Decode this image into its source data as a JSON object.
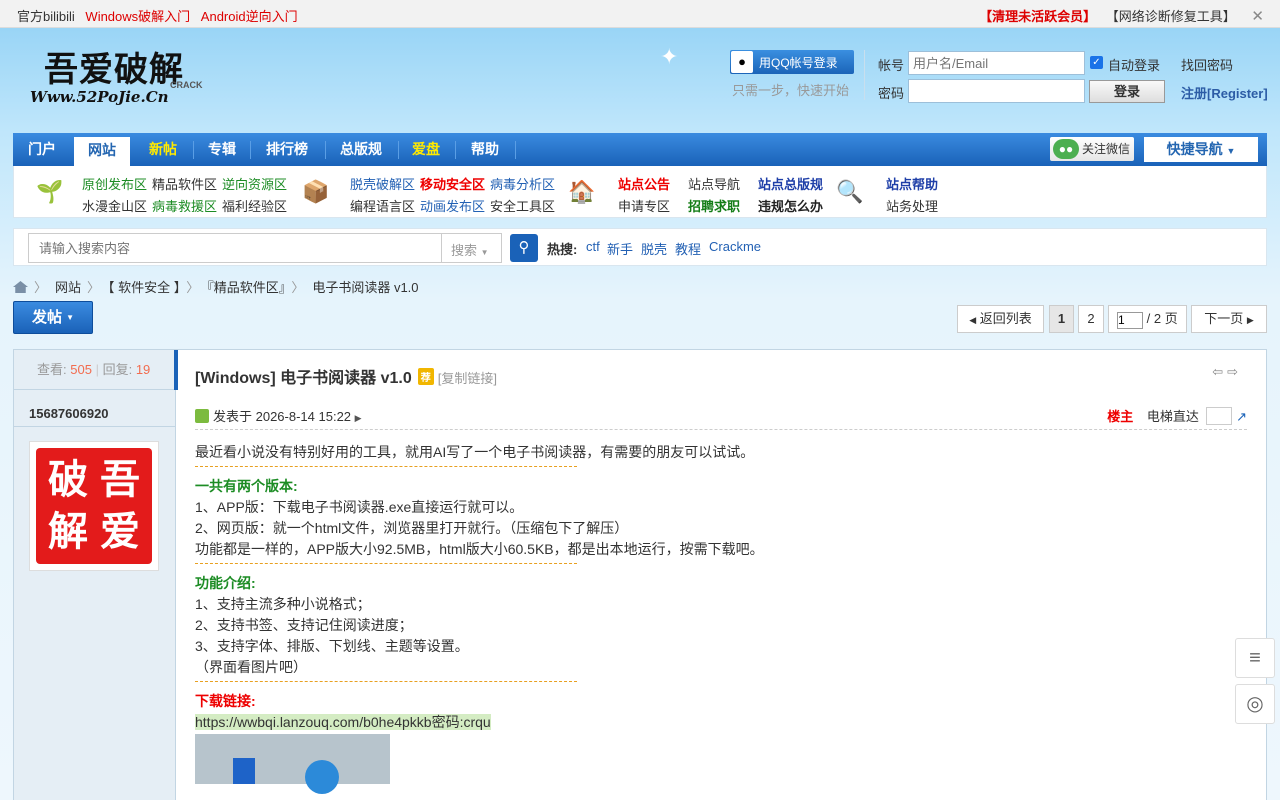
{
  "topbar": {
    "left": [
      "官方bilibili",
      "Windows破解入门",
      "Android逆向入门"
    ],
    "right": [
      "【清理未活跃会员】",
      "【网络诊断修复工具】"
    ]
  },
  "logo": {
    "line1": "吾爱破解",
    "line2": "Www.52PoJie.Cn",
    "line3": "CRACK"
  },
  "login": {
    "qq_button": "用QQ帐号登录",
    "qq_sub": "只需一步，快速开始",
    "account_label": "帐号",
    "account_placeholder": "用户名/Email",
    "auto_login": "自动登录",
    "find_password": "找回密码",
    "password_label": "密码",
    "login_button": "登录",
    "register": "注册[Register]"
  },
  "nav": {
    "items": [
      "门户",
      "网站",
      "新帖",
      "专辑",
      "排行榜",
      "总版规",
      "爱盘",
      "帮助"
    ],
    "wechat": "关注微信",
    "quick_nav": "快捷导航"
  },
  "subnav": {
    "g1": [
      "原创发布区",
      "精品软件区",
      "逆向资源区",
      "水漫金山区",
      "病毒救援区",
      "福利经验区"
    ],
    "g2": [
      "脱壳破解区",
      "移动安全区",
      "病毒分析区",
      "编程语言区",
      "动画发布区",
      "安全工具区"
    ],
    "g3": [
      "站点公告",
      "站点导航",
      "站点总版规",
      "申请专区",
      "招聘求职",
      "违规怎么办"
    ],
    "g4": [
      "站点帮助",
      "站务处理"
    ]
  },
  "search": {
    "placeholder": "请输入搜索内容",
    "select": "搜索",
    "hot_label": "热搜:",
    "hot": [
      "ctf",
      "新手",
      "脱壳",
      "教程",
      "Crackme"
    ]
  },
  "breadcrumb": [
    "网站",
    "【 软件安全 】",
    "『精品软件区』",
    "电子书阅读器 v1.0"
  ],
  "toolbar": {
    "post": "发帖",
    "back": "返回列表",
    "page1": "1",
    "page2": "2",
    "page_input": "1",
    "page_total": "/ 2 页",
    "next": "下一页"
  },
  "post": {
    "views_label": "查看:",
    "views": "505",
    "replies_label": "回复:",
    "replies": "19",
    "author": "15687606920",
    "avatar_chars": [
      "吾",
      "破",
      "爱",
      "解"
    ],
    "title": "[Windows] 电子书阅读器 v1.0",
    "title_tag": "荐",
    "copy_link": "[复制链接]",
    "posted": "发表于 2026-8-14 15:22",
    "floor": "楼主",
    "elevator": "电梯直达",
    "content": {
      "intro": "最近看小说没有特别好用的工具，就用AI写了一个电子书阅读器，有需要的朋友可以试试。",
      "h1": "一共有两个版本:",
      "v1": "1、APP版：下载电子书阅读器.exe直接运行就可以。",
      "v2": "2、网页版：就一个html文件，浏览器里打开就行。（压缩包下了解压）",
      "v3": "功能都是一样的，APP版大小92.5MB，html版大小60.5KB，都是出本地运行，按需下载吧。",
      "h2": "功能介绍:",
      "f1": "1、支持主流多种小说格式；",
      "f2": "2、支持书签、支持记住阅读进度；",
      "f3": "3、支持字体、排版、下划线、主题等设置。",
      "f4": "（界面看图片吧）",
      "h3": "下载链接:",
      "link": "https://wwbqi.lanzouq.com/b0he4pkkb密码:crqu"
    }
  }
}
